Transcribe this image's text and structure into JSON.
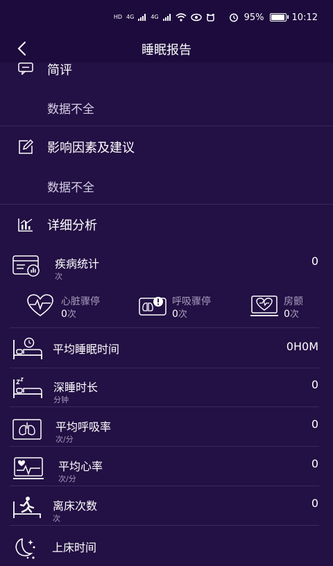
{
  "status_bar": {
    "network_labels": [
      "HD",
      "4G",
      "4G"
    ],
    "battery": "95%",
    "battery_level": 0.95,
    "time": "10:12"
  },
  "nav": {
    "title": "睡眠报告"
  },
  "summary": {
    "title": "简评",
    "note": "数据不全"
  },
  "factors": {
    "title": "影响因素及建议",
    "note": "数据不全"
  },
  "analysis": {
    "title": "详细分析"
  },
  "disease": {
    "label": "疾病统计",
    "unit": "次",
    "value": "0",
    "items": [
      {
        "label": "心脏骤停",
        "count": "0",
        "unit": "次"
      },
      {
        "label": "呼吸骤停",
        "count": "0",
        "unit": "次"
      },
      {
        "label": "房颤",
        "count": "0",
        "unit": "次"
      }
    ]
  },
  "metrics": [
    {
      "label": "平均睡眠时间",
      "unit": "",
      "value": "0H0M",
      "icon": "bed-clock-icon"
    },
    {
      "label": "深睡时长",
      "unit": "分钟",
      "value": "0",
      "icon": "deep-sleep-bed-icon"
    },
    {
      "label": "平均呼吸率",
      "unit": "次/分",
      "value": "0",
      "icon": "lungs-icon"
    },
    {
      "label": "平均心率",
      "unit": "次/分",
      "value": "0",
      "icon": "heart-rate-monitor-icon"
    },
    {
      "label": "离床次数",
      "unit": "次",
      "value": "0",
      "icon": "leave-bed-icon"
    },
    {
      "label": "上床时间",
      "unit": "",
      "value": "",
      "icon": "moon-stars-icon"
    }
  ],
  "colors": {
    "background": "#231044",
    "header": "#1d0b3d",
    "divider": "#3a2a5e",
    "muted_text": "#a79cbf"
  }
}
